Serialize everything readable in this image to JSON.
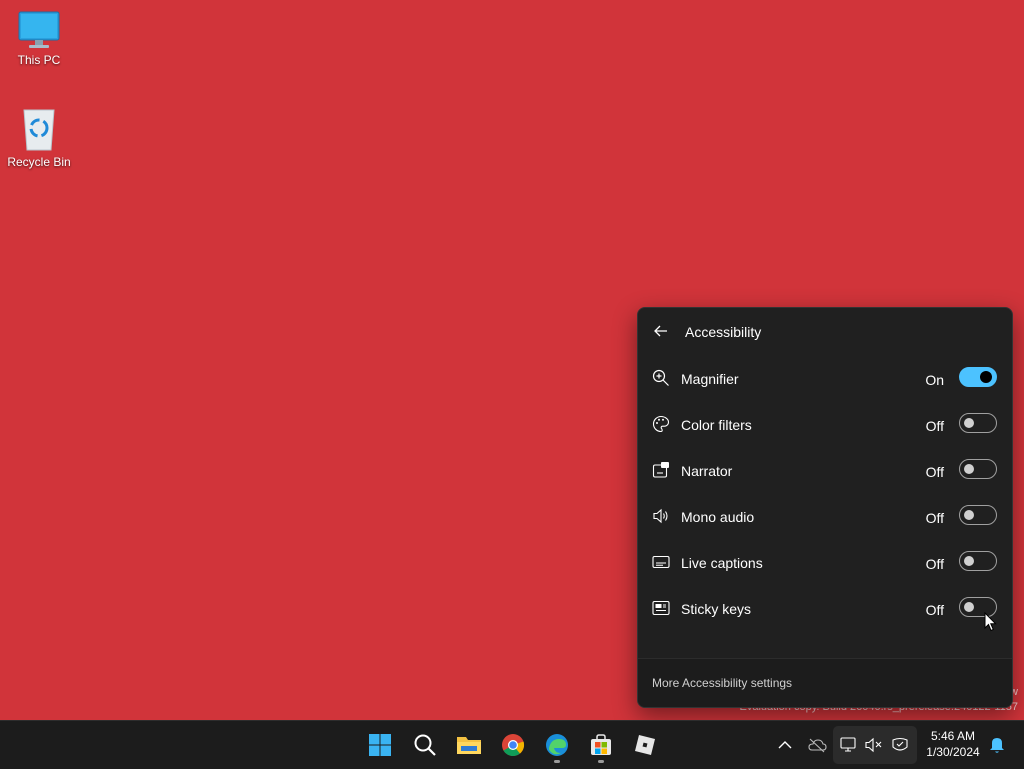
{
  "desktop": {
    "icons": [
      {
        "label": "This PC"
      },
      {
        "label": "Recycle Bin"
      }
    ],
    "watermark": {
      "line1": "w",
      "line2": "Evaluation copy. Build 26040.rs_prerelease.240122-1157"
    }
  },
  "flyout": {
    "title": "Accessibility",
    "back_icon": "arrow-left-icon",
    "items": [
      {
        "label": "Magnifier",
        "state": "On",
        "icon": "magnifier-icon"
      },
      {
        "label": "Color filters",
        "state": "Off",
        "icon": "palette-icon"
      },
      {
        "label": "Narrator",
        "state": "Off",
        "icon": "narrator-icon"
      },
      {
        "label": "Mono audio",
        "state": "Off",
        "icon": "speaker-icon"
      },
      {
        "label": "Live captions",
        "state": "Off",
        "icon": "captions-icon"
      },
      {
        "label": "Sticky keys",
        "state": "Off",
        "icon": "keyboard-icon"
      }
    ],
    "footer_link": "More Accessibility settings",
    "accent": "#4cc2ff"
  },
  "taskbar": {
    "apps": [
      "start",
      "search",
      "file-explorer",
      "chrome",
      "edge",
      "microsoft-store",
      "roblox"
    ],
    "clock": {
      "time": "5:46 AM",
      "date": "1/30/2024"
    }
  },
  "colors": {
    "desktop": "#d1343a",
    "flyout_bg": "#202020",
    "taskbar_bg": "#1c1c1c"
  }
}
